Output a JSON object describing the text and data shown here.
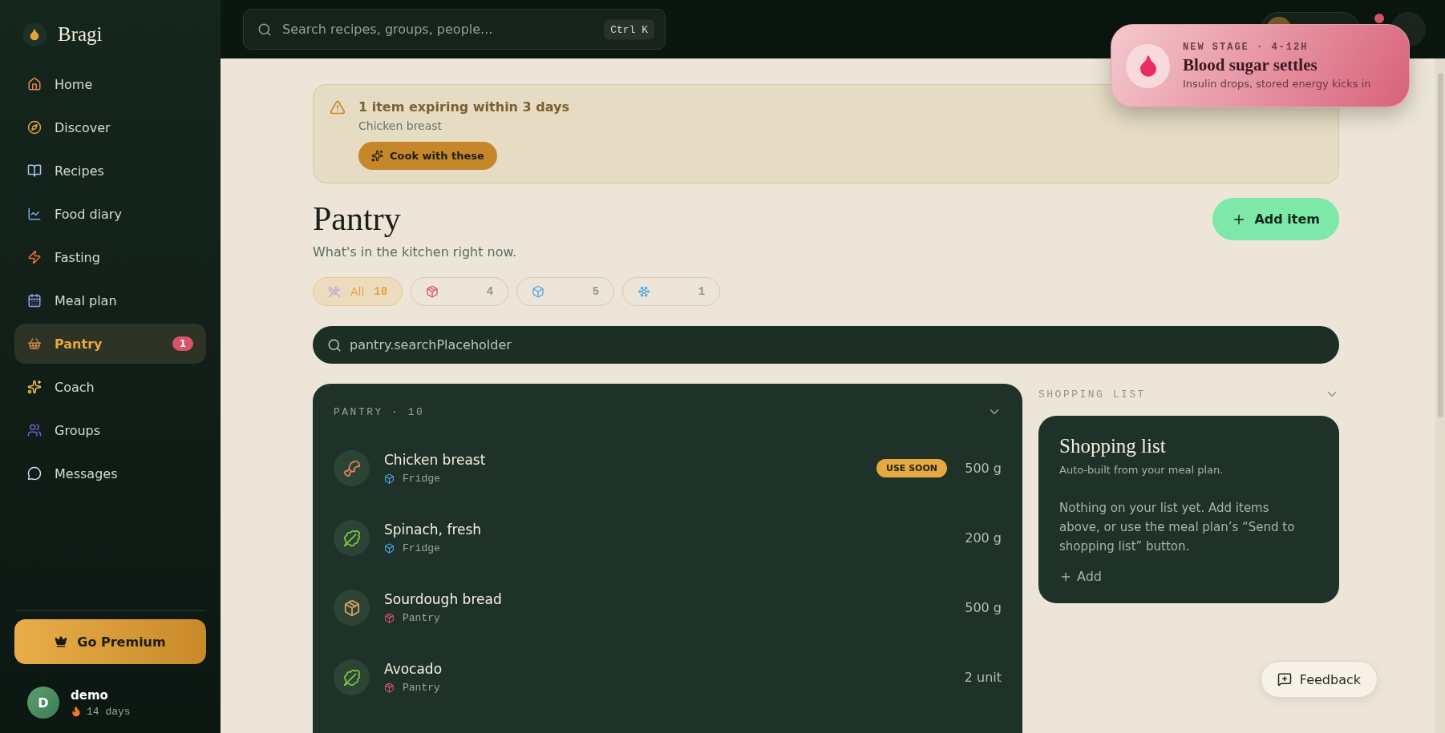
{
  "sidebar": {
    "brand": "Bragi",
    "items": [
      {
        "kind": "home",
        "label": "Home",
        "selected": false
      },
      {
        "kind": "discover",
        "label": "Discover",
        "selected": false
      },
      {
        "kind": "recipes",
        "label": "Recipes",
        "selected": false
      },
      {
        "kind": "diary",
        "label": "Food diary",
        "selected": false
      },
      {
        "kind": "fasting",
        "label": "Fasting",
        "selected": false
      },
      {
        "kind": "mealplan",
        "label": "Meal plan",
        "selected": false
      },
      {
        "kind": "pantry",
        "label": "Pantry",
        "selected": true,
        "badge": "1"
      },
      {
        "kind": "coach",
        "label": "Coach",
        "selected": false
      },
      {
        "kind": "groups",
        "label": "Groups",
        "selected": false
      },
      {
        "kind": "messages",
        "label": "Messages",
        "selected": false
      }
    ],
    "premium_button": "Go Premium",
    "user": {
      "initial": "D",
      "name": "demo",
      "streak": "14 days"
    }
  },
  "top_bar": {
    "search": {
      "placeholder": "Search recipes, groups, people...",
      "shortcut": "Ctrl K"
    }
  },
  "toast": {
    "eyebrow": "NEW STAGE · 4-12H",
    "title": "Blood sugar settles",
    "text": "Insulin drops, stored energy kicks in"
  },
  "alert": {
    "title": "1 item expiring within 3 days",
    "items": "Chicken breast",
    "button": "Cook with these"
  },
  "header": {
    "title": "Pantry",
    "subtitle": "What's in the kitchen right now.",
    "add_button": "Add item"
  },
  "filters": [
    {
      "kind": "all",
      "label": "All",
      "count": "10",
      "selected": true
    },
    {
      "kind": "pantry",
      "count": "4",
      "selected": false
    },
    {
      "kind": "fridge",
      "count": "5",
      "selected": false
    },
    {
      "kind": "freezer",
      "count": "1",
      "selected": false
    }
  ],
  "search": {
    "placeholder": "pantry.searchPlaceholder"
  },
  "pantry": {
    "heading": "PANTRY · 10",
    "items": [
      {
        "kind": "meat",
        "name": "Chicken breast",
        "location": {
          "kind": "fridge",
          "label": "Fridge"
        },
        "badge": "USE SOON",
        "amount": "500 g"
      },
      {
        "kind": "greens",
        "name": "Spinach, fresh",
        "location": {
          "kind": "fridge",
          "label": "Fridge"
        },
        "amount": "200 g"
      },
      {
        "kind": "bread",
        "name": "Sourdough bread",
        "location": {
          "kind": "pantry",
          "label": "Pantry"
        },
        "amount": "500 g"
      },
      {
        "kind": "greens",
        "name": "Avocado",
        "location": {
          "kind": "pantry",
          "label": "Pantry"
        },
        "amount": "2 unit"
      }
    ]
  },
  "shopping": {
    "heading": "SHOPPING LIST",
    "title": "Shopping list",
    "subtitle": "Auto-built from your meal plan.",
    "empty_text": "Nothing on your list yet. Add items above, or use the meal plan’s “Send to shopping list” button.",
    "add": "Add"
  },
  "feedback_button": "Feedback"
}
